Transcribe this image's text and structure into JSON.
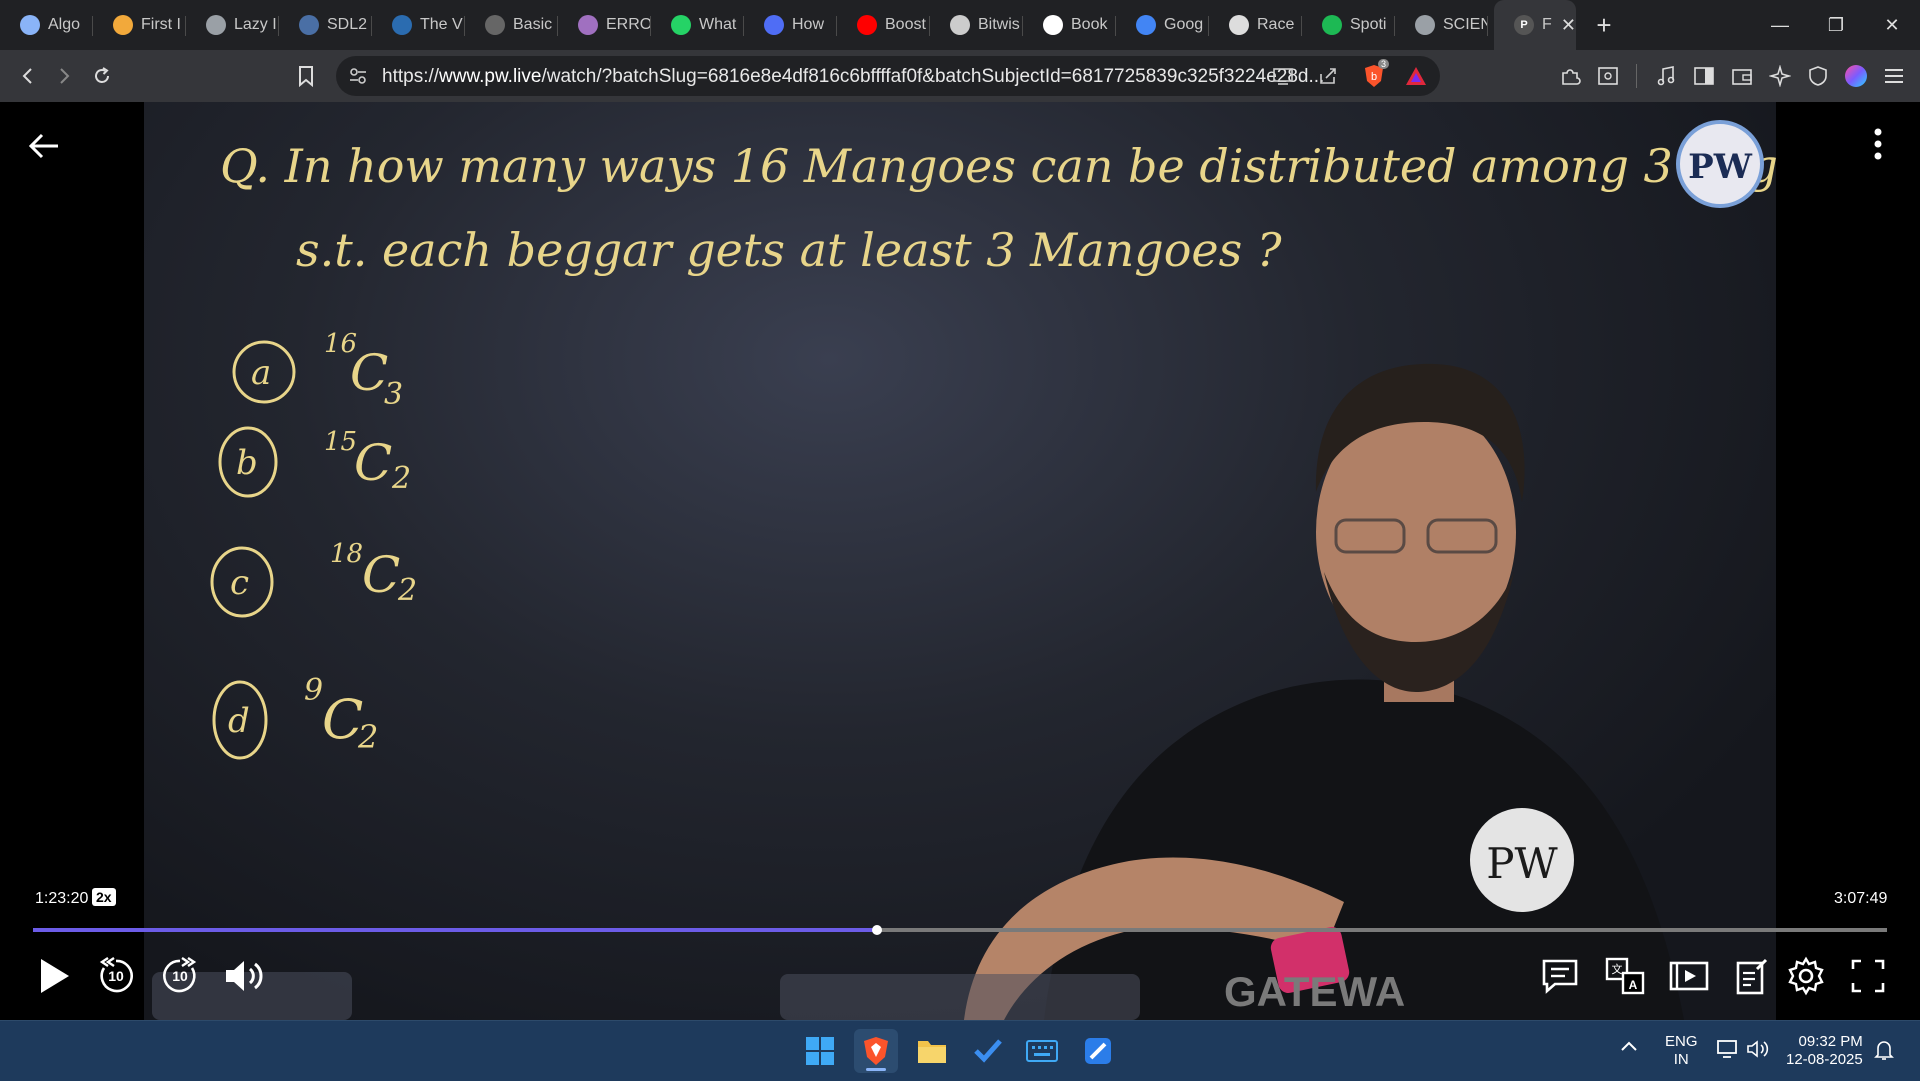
{
  "browser": {
    "tabs": [
      {
        "title": "Algo",
        "icon": "globe-icon",
        "color": "#8ab4f8"
      },
      {
        "title": "First I",
        "icon": "bars-icon",
        "color": "#f2a93b"
      },
      {
        "title": "Lazy I",
        "icon": "globe-icon",
        "color": "#9aa0a6"
      },
      {
        "title": "SDL2",
        "icon": "sdl-icon",
        "color": "#4a6fa5"
      },
      {
        "title": "The V",
        "icon": "w3-icon",
        "color": "#2b6cb0"
      },
      {
        "title": "Basic",
        "icon": "h-icon",
        "color": "#666666"
      },
      {
        "title": "ERRO",
        "icon": "brain-icon",
        "color": "#a070c0"
      },
      {
        "title": "What",
        "icon": "whatsapp-icon",
        "color": "#25d366"
      },
      {
        "title": "How",
        "icon": "bookmark-icon",
        "color": "#4f6df5"
      },
      {
        "title": "Boost",
        "icon": "youtube-icon",
        "color": "#ff0000"
      },
      {
        "title": "Bitwis",
        "icon": "gfg-icon",
        "color": "#cccccc"
      },
      {
        "title": "Book",
        "icon": "google-icon",
        "color": "#ffffff"
      },
      {
        "title": "Goog",
        "icon": "gemini-icon",
        "color": "#4285f4"
      },
      {
        "title": "Race",
        "icon": "openai-icon",
        "color": "#dddddd"
      },
      {
        "title": "Spoti",
        "icon": "spotify-icon",
        "color": "#1db954"
      },
      {
        "title": "SCIEN",
        "icon": "globe-icon",
        "color": "#9aa0a6"
      }
    ],
    "active_tab": {
      "title": "F",
      "icon": "pw-icon"
    },
    "new_tab": "+",
    "url": "https://www.pw.live/watch/?batchSlug=6816e8e4df816c6bffffaf0f&batchSubjectId=6817725839c325f3224e28d...",
    "url_domain": "www.pw.live",
    "url_prefix": "https://",
    "url_rest": "/watch/?batchSlug=6816e8e4df816c6bffffaf0f&batchSubjectId=6817725839c325f3224e28d...",
    "brave_badge": "3"
  },
  "lecture": {
    "question_line1": "Q. In how many ways 16 Mangoes can be distributed among 3 Beggars",
    "question_line2": "s.t. each beggar gets at least 3 Mangoes ?",
    "options": [
      {
        "label": "a",
        "expr_pre": "16",
        "expr_post": "3"
      },
      {
        "label": "b",
        "expr_pre": "15",
        "expr_post": "2"
      },
      {
        "label": "c",
        "expr_pre": "18",
        "expr_post": "2"
      },
      {
        "label": "d",
        "expr_pre": "9",
        "expr_post": "2"
      }
    ],
    "logo_text": "PW",
    "shirt_logo": "PW",
    "bottom_text": "GATEWA"
  },
  "player": {
    "current_time": "1:23:20",
    "speed": "2x",
    "total_time": "3:07:49",
    "progress_fraction": 0.455,
    "rewind_label": "10",
    "forward_label": "10"
  },
  "taskbar": {
    "lang_top": "ENG",
    "lang_bottom": "IN",
    "time": "09:32 PM",
    "date": "12-08-2025"
  }
}
